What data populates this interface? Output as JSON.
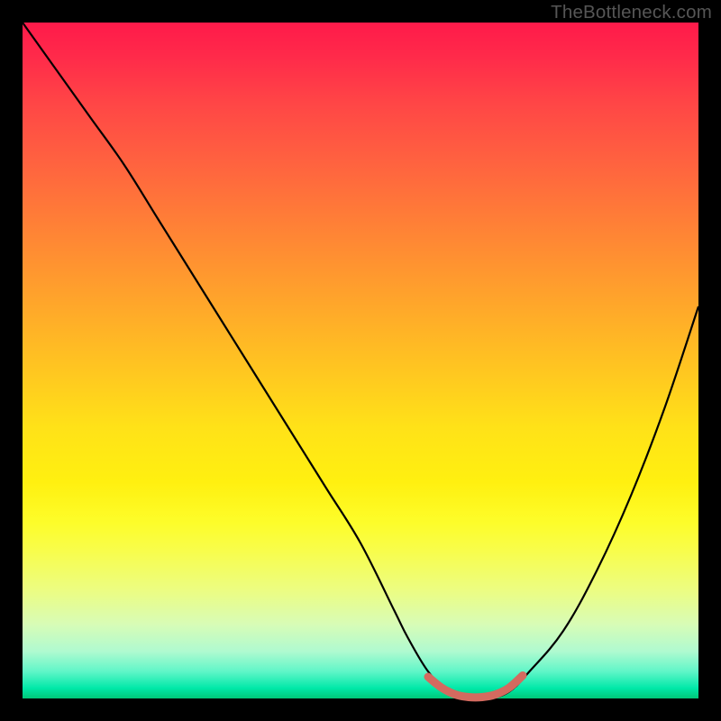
{
  "watermark": "TheBottleneck.com",
  "chart_data": {
    "type": "line",
    "title": "",
    "xlabel": "",
    "ylabel": "",
    "xlim": [
      0,
      100
    ],
    "ylim": [
      0,
      100
    ],
    "series": [
      {
        "name": "main-curve",
        "color": "#000000",
        "x": [
          0,
          5,
          10,
          15,
          20,
          25,
          30,
          35,
          40,
          45,
          50,
          55,
          57,
          60,
          63,
          66,
          69,
          72,
          75,
          80,
          85,
          90,
          95,
          100
        ],
        "values": [
          100,
          93,
          86,
          79,
          71,
          63,
          55,
          47,
          39,
          31,
          23,
          13,
          9,
          4,
          1,
          0,
          0,
          1,
          4,
          10,
          19,
          30,
          43,
          58
        ]
      },
      {
        "name": "bottom-highlight",
        "color": "#d46a5f",
        "x": [
          60,
          62,
          64,
          66,
          68,
          70,
          72,
          74
        ],
        "values": [
          3.2,
          1.6,
          0.6,
          0.2,
          0.2,
          0.6,
          1.6,
          3.4
        ]
      }
    ],
    "background_gradient": {
      "stops": [
        {
          "pos": 0.0,
          "color": "#ff1a4a"
        },
        {
          "pos": 0.2,
          "color": "#ff6040"
        },
        {
          "pos": 0.4,
          "color": "#ffa828"
        },
        {
          "pos": 0.6,
          "color": "#ffe218"
        },
        {
          "pos": 0.78,
          "color": "#f8fd4a"
        },
        {
          "pos": 0.9,
          "color": "#d0fcc0"
        },
        {
          "pos": 1.0,
          "color": "#00c878"
        }
      ]
    }
  }
}
